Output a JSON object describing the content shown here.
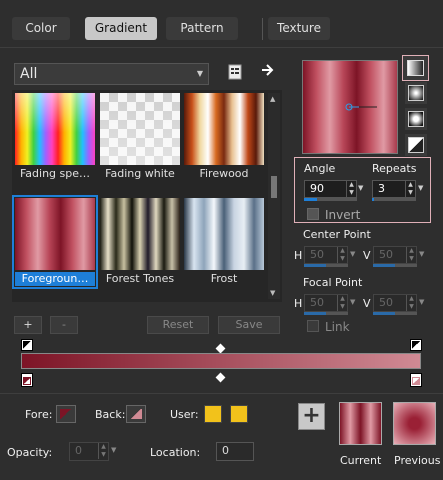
{
  "tabs": [
    {
      "label": "Color"
    },
    {
      "label": "Gradient"
    },
    {
      "label": "Pattern"
    },
    {
      "label": "Texture"
    }
  ],
  "category": {
    "value": "All"
  },
  "gradients": [
    {
      "label": "Fading spe…"
    },
    {
      "label": "Fading white"
    },
    {
      "label": "Firewood"
    },
    {
      "label": "Foregroun…"
    },
    {
      "label": "Forest Tones"
    },
    {
      "label": "Frost"
    }
  ],
  "buttons": {
    "add": "+",
    "remove": "-",
    "reset": "Reset",
    "save": "Save"
  },
  "angle": {
    "label": "Angle",
    "value": "90"
  },
  "repeats": {
    "label": "Repeats",
    "value": "3"
  },
  "invert": {
    "label": "Invert"
  },
  "center_point": {
    "label": "Center Point",
    "h_label": "H",
    "h_value": "50",
    "v_label": "V",
    "v_value": "50"
  },
  "focal_point": {
    "label": "Focal Point",
    "h_label": "H",
    "h_value": "50",
    "v_label": "V",
    "v_value": "50"
  },
  "link": {
    "label": "Link"
  },
  "fore": {
    "label": "Fore:"
  },
  "back": {
    "label": "Back:"
  },
  "user": {
    "label": "User:"
  },
  "opacity": {
    "label": "Opacity:",
    "value": "0"
  },
  "location": {
    "label": "Location:",
    "value": "0"
  },
  "current": {
    "label": "Current"
  },
  "previous": {
    "label": "Previous"
  },
  "colors": {
    "foreground": "#7d1426",
    "background": "#d08a94",
    "user_1": "#f2c21b",
    "user_2": "#f2c21b",
    "accent": "#1e7fd8",
    "highlight_border": "#e0b0b8"
  }
}
